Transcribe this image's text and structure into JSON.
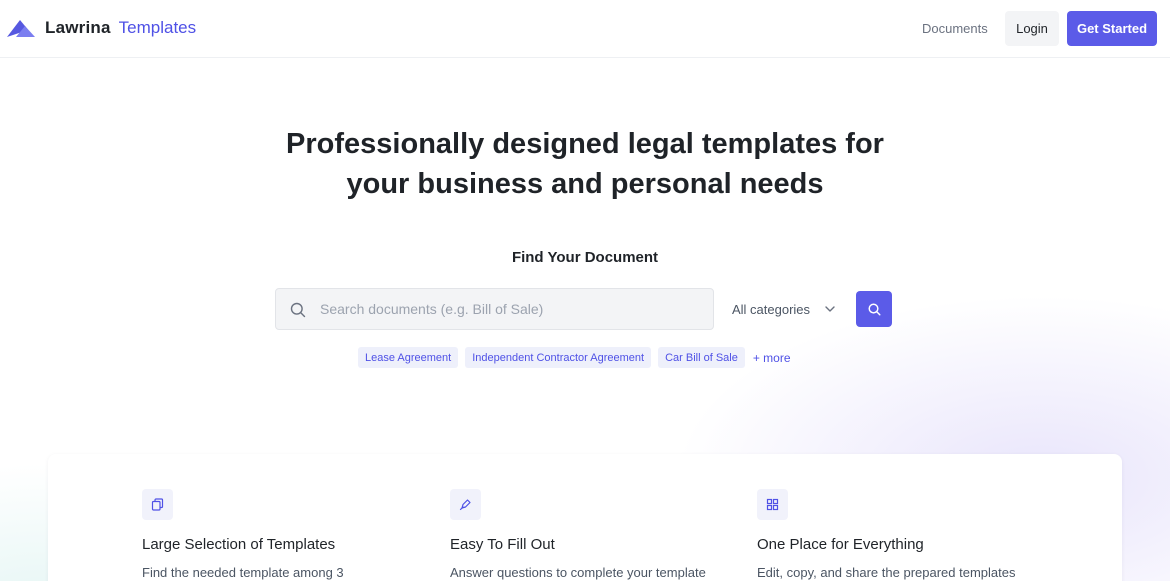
{
  "header": {
    "brand_name": "Lawrina",
    "brand_sub": "Templates",
    "nav_documents": "Documents",
    "login_label": "Login",
    "get_started_label": "Get Started"
  },
  "hero": {
    "title_line1": "Professionally designed legal templates for",
    "title_line2": "your business and personal needs"
  },
  "search": {
    "section_label": "Find Your Document",
    "value": "",
    "placeholder": "Search documents (e.g. Bill of Sale)",
    "category_selected": "All categories",
    "tags": [
      "Lease Agreement",
      "Independent Contractor Agreement",
      "Car Bill of Sale"
    ],
    "more_label": "+ more"
  },
  "features": [
    {
      "icon": "copy-icon",
      "title": "Large Selection of Templates",
      "description": "Find the needed template among 3"
    },
    {
      "icon": "pen-icon",
      "title": "Easy To Fill Out",
      "description": "Answer questions to complete your template"
    },
    {
      "icon": "grid-icon",
      "title": "One Place for Everything",
      "description": "Edit, copy, and share the prepared templates"
    }
  ],
  "colors": {
    "accent": "#5b5be8",
    "brand_text": "#4f51e6",
    "tag_bg": "#eef0fb"
  }
}
